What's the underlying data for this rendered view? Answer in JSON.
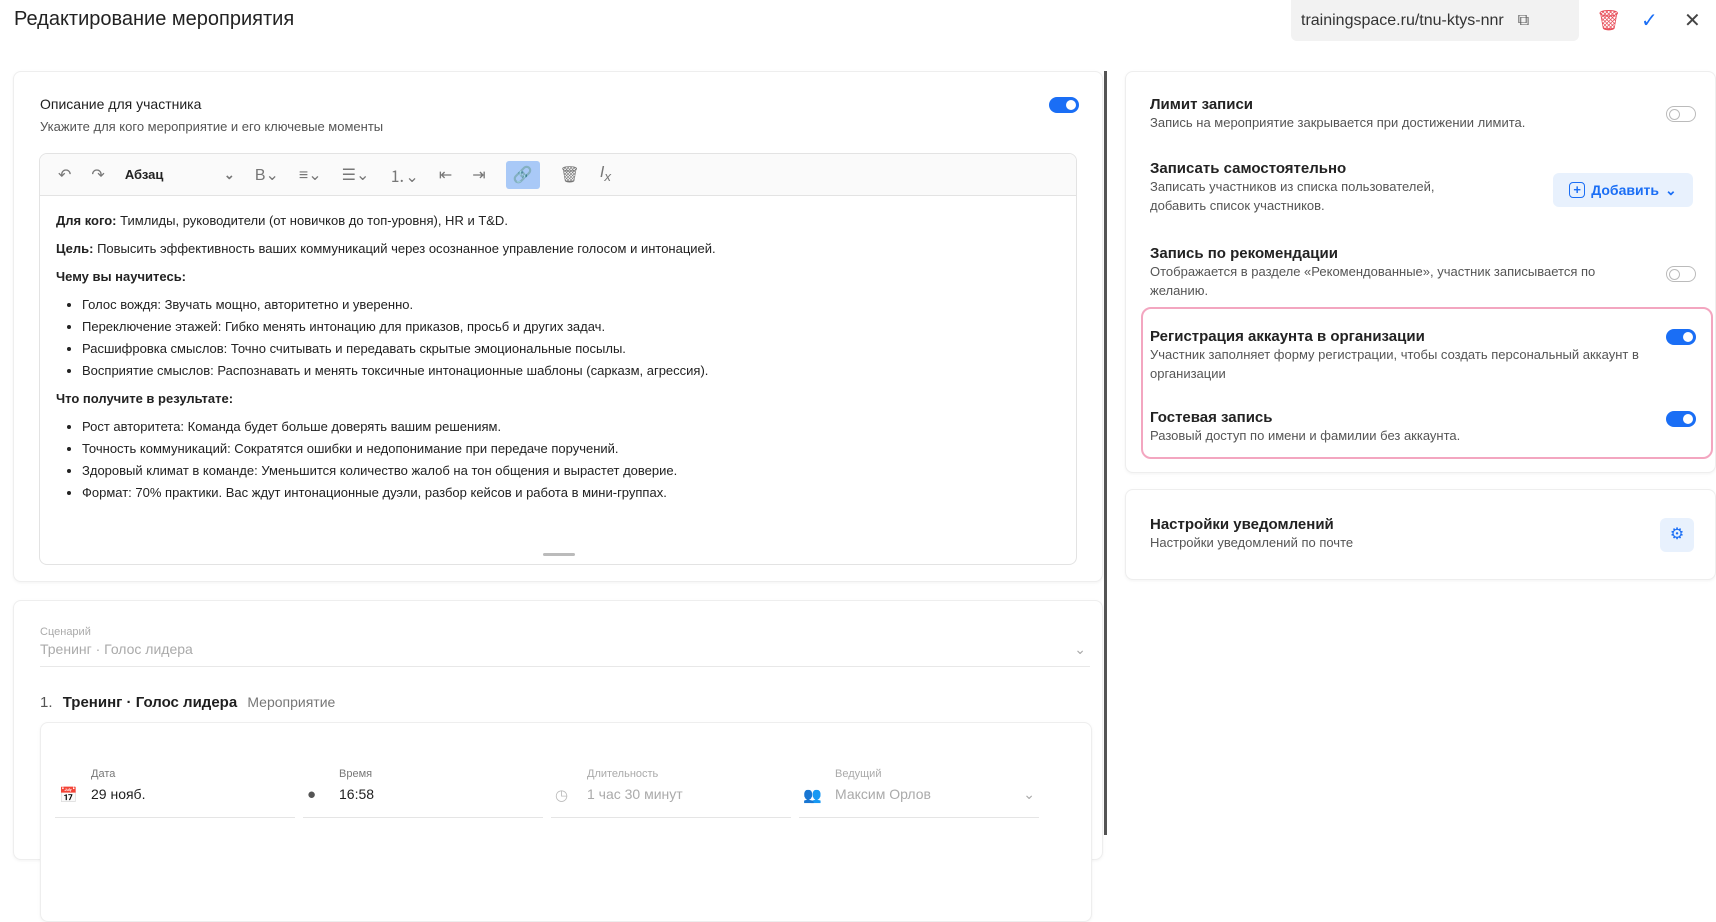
{
  "header": {
    "title": "Редактирование мероприятия",
    "url": "trainingspace.ru/tnu-ktys-nnr"
  },
  "description": {
    "title": "Описание для участника",
    "subtitle": "Укажите для кого мероприятие и его ключевые моменты",
    "enabled": true,
    "toolbar": {
      "paragraph": "Абзац"
    },
    "content": {
      "p1_label": "Для кого:",
      "p1": " Тимлиды, руководители (от новичков до топ-уровня), HR и T&D.",
      "p2_label": "Цель:",
      "p2": " Повысить эффективность ваших коммуникаций через осознанное управление голосом и интонацией.",
      "h1": "Чему вы научитесь:",
      "list1": [
        "Голос вождя: Звучать мощно, авторитетно и уверенно.",
        "Переключение этажей: Гибко менять интонацию для приказов, просьб и других задач.",
        "Расшифровка смыслов: Точно считывать и передавать скрытые эмоциональные посылы.",
        "Восприятие смыслов: Распознавать и менять токсичные интонационные шаблоны (сарказм, агрессия)."
      ],
      "h2": "Что получите в результате:",
      "list2": [
        "Рост авторитета: Команда будет больше доверять вашим решениям.",
        "Точность коммуникаций: Сократятся ошибки и недопонимание при передаче поручений.",
        "Здоровый климат в команде: Уменьшится количество жалоб на тон общения и вырастет доверие.",
        "Формат: 70% практики. Вас ждут интонационные дуэли, разбор кейсов и работа в мини-группах."
      ]
    }
  },
  "scenario": {
    "label": "Сценарий",
    "value": "Тренинг · Голос лидера",
    "item_number": "1.",
    "item_title": "Тренинг · Голос лидера",
    "item_type": "Мероприятие",
    "fields": {
      "date_label": "Дата",
      "date": "29 нояб.",
      "time_label": "Время",
      "time": "16:58",
      "duration_label": "Длительность",
      "duration": "1 час 30 минут",
      "host_label": "Ведущий",
      "host": "Максим Орлов"
    }
  },
  "settings": [
    {
      "title": "Лимит записи",
      "desc": "Запись на мероприятие закрывается при достижении лимита.",
      "on": false
    },
    {
      "title": "Записать самостоятельно",
      "desc": "Записать участников из списка пользователей, добавить список участников.",
      "button": "Добавить"
    },
    {
      "title": "Запись по рекомендации",
      "desc": "Отображается в разделе «Рекомендованные», участник записывается по желанию.",
      "on": false
    },
    {
      "title": "Регистрация аккаунта в организации",
      "desc": "Участник заполняет форму регистрации, чтобы создать персональный аккаунт в организации",
      "on": true
    },
    {
      "title": "Гостевая запись",
      "desc": "Разовый доступ по имени и фамилии без аккаунта.",
      "on": true
    }
  ],
  "notifications": {
    "title": "Настройки уведомлений",
    "desc": "Настройки уведомлений по почте"
  },
  "colors": {
    "accent": "#1a6ef5",
    "highlight": "#f3a6c0",
    "delete": "#e8505b"
  }
}
